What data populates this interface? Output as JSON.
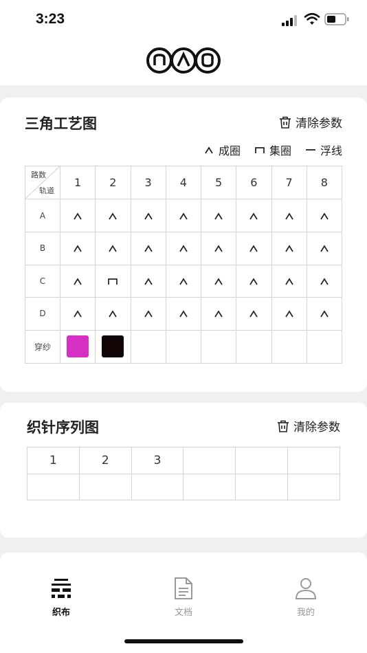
{
  "status": {
    "time": "3:23"
  },
  "header": {
    "logo": "nao-logo"
  },
  "card1": {
    "title": "三角工艺图",
    "clear_label": "清除参数",
    "legend": [
      {
        "icon": "caret-up-icon",
        "label": "成圈"
      },
      {
        "icon": "tuck-icon",
        "label": "集圈"
      },
      {
        "icon": "dash-icon",
        "label": "浮线"
      }
    ],
    "corner_top": "路数",
    "corner_bottom": "轨道",
    "columns": [
      "1",
      "2",
      "3",
      "4",
      "5",
      "6",
      "7",
      "8"
    ],
    "rows": [
      {
        "label": "A",
        "cells": [
          "knit",
          "knit",
          "knit",
          "knit",
          "knit",
          "knit",
          "knit",
          "knit"
        ]
      },
      {
        "label": "B",
        "cells": [
          "knit",
          "knit",
          "knit",
          "knit",
          "knit",
          "knit",
          "knit",
          "knit"
        ]
      },
      {
        "label": "C",
        "cells": [
          "knit",
          "tuck",
          "knit",
          "knit",
          "knit",
          "knit",
          "knit",
          "knit"
        ]
      },
      {
        "label": "D",
        "cells": [
          "knit",
          "knit",
          "knit",
          "knit",
          "knit",
          "knit",
          "knit",
          "knit"
        ]
      }
    ],
    "yarn_label": "穿纱",
    "yarn_colors": [
      "#d430c4",
      "#120404",
      "",
      "",
      "",
      "",
      "",
      ""
    ]
  },
  "card2": {
    "title": "织针序列图",
    "clear_label": "清除参数",
    "header_cells": [
      "1",
      "2",
      "3",
      "",
      "",
      ""
    ],
    "body_cells": [
      "",
      "",
      "",
      "",
      "",
      ""
    ]
  },
  "card3": {
    "title_partial": "",
    "legend_partial": ""
  },
  "tabbar": {
    "tabs": [
      {
        "label": "织布",
        "icon": "fabric-icon",
        "active": true
      },
      {
        "label": "文档",
        "icon": "document-icon",
        "active": false
      },
      {
        "label": "我的",
        "icon": "user-icon",
        "active": false
      }
    ]
  },
  "colors": {
    "accent": "#111111",
    "inactive": "#999999",
    "yarn1": "#d430c4",
    "yarn2": "#120404"
  }
}
